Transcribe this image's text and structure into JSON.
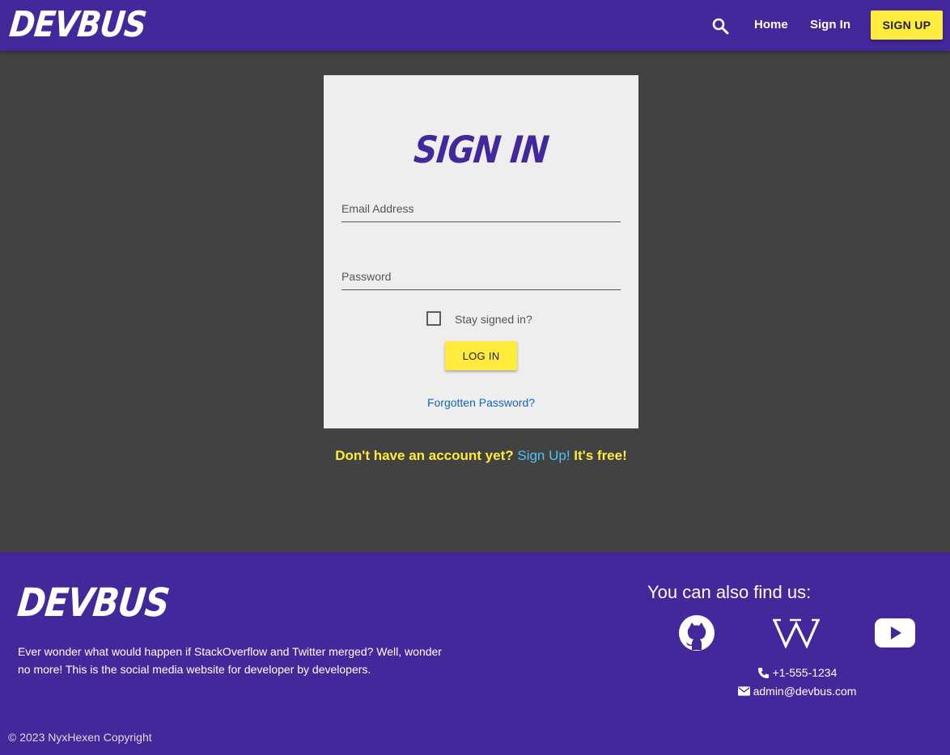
{
  "nav": {
    "logo": "DEVBUS",
    "search_icon": "search-icon",
    "home": "Home",
    "sign_in": "Sign In",
    "sign_up": "SIGN UP"
  },
  "card": {
    "title": "SIGN IN",
    "email_placeholder": "Email Address",
    "email_value": "",
    "password_placeholder": "Password",
    "password_value": "",
    "stay_signed_in": "Stay signed in?",
    "stay_signed_in_checked": false,
    "login": "LOG IN",
    "forgot": "Forgotten Password?"
  },
  "promo": {
    "prefix": "Don't have an account yet?",
    "link": "Sign Up!",
    "suffix": "It's free!"
  },
  "footer": {
    "logo": "DEVBUS",
    "description": "Ever wonder what would happen if StackOverflow and Twitter merged? Well, wonder no more! This is the social media website for developer by developers.",
    "find_us": "You can also find us:",
    "social": [
      "github-icon",
      "wikipedia-icon",
      "youtube-icon"
    ],
    "phone": "+1-555-1234",
    "email": "admin@devbus.com",
    "copyright": "© 2023 NyxHexen Copyright"
  },
  "colors": {
    "brand_purple": "#43289b",
    "accent_yellow": "#ffeb3b",
    "background_gray": "#424242",
    "card_gray": "#eeeeee",
    "link_blue": "#1565c0",
    "promo_link": "#4fc3f7"
  }
}
